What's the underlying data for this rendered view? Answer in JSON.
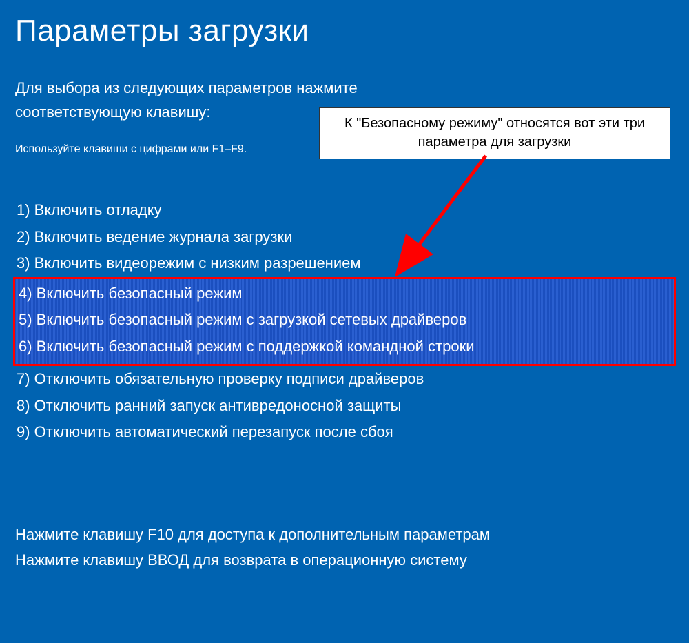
{
  "title": "Параметры загрузки",
  "intro": "Для выбора из следующих параметров нажмите соответствующую клавишу:",
  "hint": "Используйте клавиши с цифрами или F1–F9.",
  "options": [
    "1) Включить отладку",
    "2) Включить ведение журнала загрузки",
    "3) Включить видеорежим с низким разрешением",
    "4) Включить безопасный режим",
    "5) Включить безопасный режим с загрузкой сетевых драйверов",
    "6) Включить безопасный режим с поддержкой командной строки",
    "7) Отключить обязательную проверку подписи драйверов",
    "8) Отключить ранний запуск антивредоносной защиты",
    "9) Отключить автоматический перезапуск после сбоя"
  ],
  "footer": {
    "line1": "Нажмите клавишу F10 для доступа к дополнительным параметрам",
    "line2": "Нажмите клавишу ВВОД для возврата в операционную систему"
  },
  "callout": "К \"Безопасному режиму\" относятся вот эти три параметра для загрузки"
}
